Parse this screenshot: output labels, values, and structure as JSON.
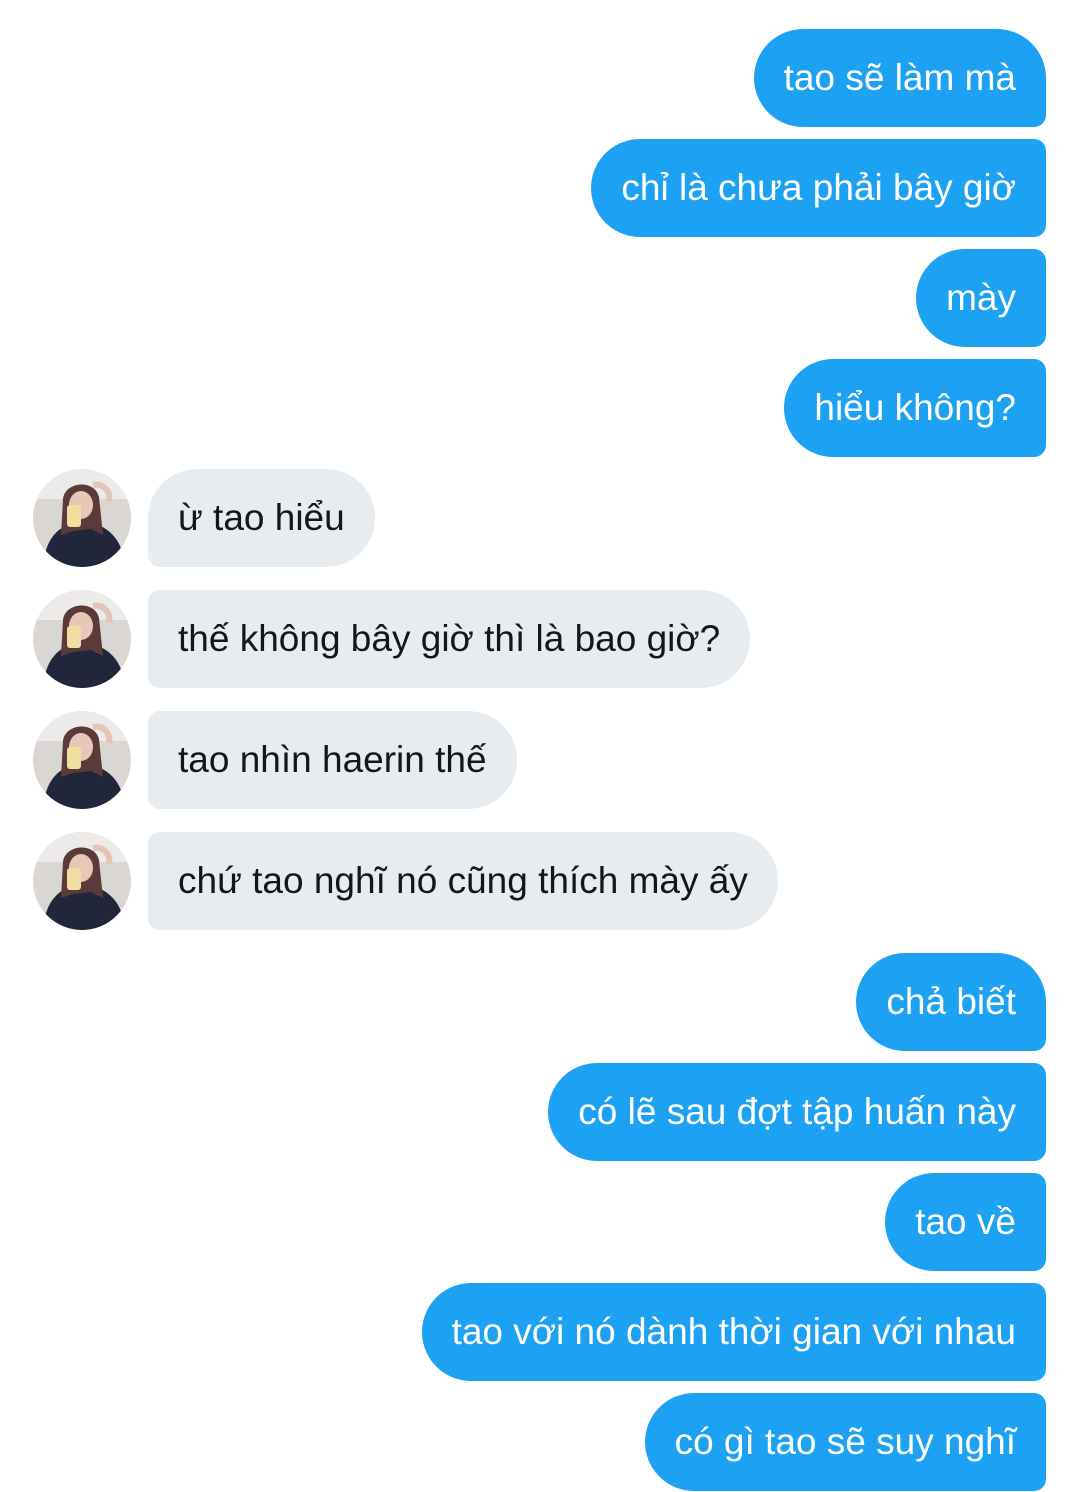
{
  "conversation": {
    "messages": [
      {
        "direction": "sent",
        "text": "tao sẽ làm mà"
      },
      {
        "direction": "sent",
        "text": "chỉ là chưa phải bây giờ"
      },
      {
        "direction": "sent",
        "text": "mày"
      },
      {
        "direction": "sent",
        "text": "hiểu không?"
      },
      {
        "direction": "received",
        "text": "ừ tao hiểu",
        "avatar_icon": "user-avatar-icon"
      },
      {
        "direction": "received",
        "text": "thế không bây giờ thì là bao giờ?",
        "avatar_icon": "user-avatar-icon"
      },
      {
        "direction": "received",
        "text": "tao nhìn haerin thế",
        "avatar_icon": "user-avatar-icon"
      },
      {
        "direction": "received",
        "text": "chứ tao nghĩ nó cũng thích mày ấy",
        "avatar_icon": "user-avatar-icon"
      },
      {
        "direction": "sent",
        "text": "chả biết"
      },
      {
        "direction": "sent",
        "text": "có lẽ sau đợt tập huấn này"
      },
      {
        "direction": "sent",
        "text": "tao về"
      },
      {
        "direction": "sent",
        "text": "tao với nó dành thời gian với nhau"
      },
      {
        "direction": "sent",
        "text": "có gì tao sẽ suy nghĩ"
      }
    ]
  },
  "colors": {
    "sent_bubble": "#1da1f2",
    "sent_text": "#ffffff",
    "received_bubble": "#e6ecf0",
    "received_text": "#14171a",
    "background": "#ffffff"
  }
}
